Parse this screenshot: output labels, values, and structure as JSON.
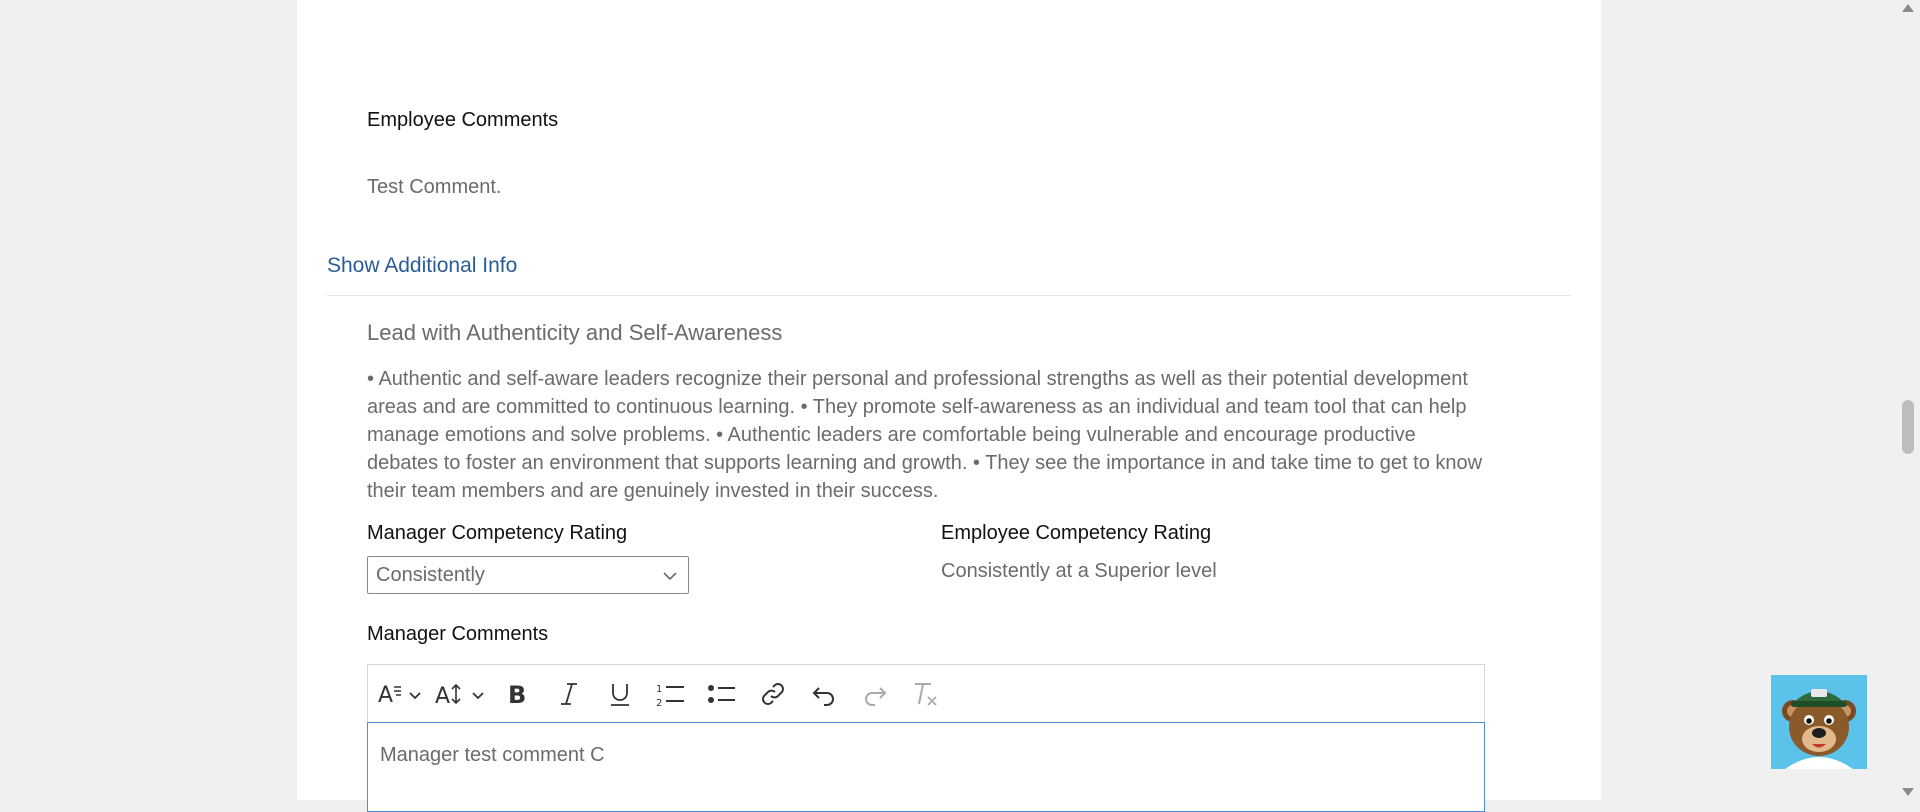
{
  "employee_comments": {
    "label": "Employee Comments",
    "text": "Test Comment."
  },
  "show_additional_info": "Show Additional Info",
  "competency": {
    "title": "Lead with Authenticity and Self-Awareness",
    "description": "• Authentic and self-aware leaders recognize their personal and professional strengths as well as their potential development areas and are committed to continuous learning. • They promote self-awareness as an individual and team tool that can help manage emotions and solve problems. • Authentic leaders are comfortable being vulnerable and encourage productive debates to foster an environment that supports learning and growth. • They see the importance in and take time to get to know their team members and are genuinely invested in their success.",
    "manager_rating_label": "Manager Competency Rating",
    "manager_rating_value": "Consistently",
    "employee_rating_label": "Employee Competency Rating",
    "employee_rating_value": "Consistently at a Superior level"
  },
  "manager_comments": {
    "label": "Manager Comments",
    "text": "Manager test comment C"
  },
  "toolbar": {
    "items": [
      "font-style-icon",
      "font-size-icon",
      "bold-icon",
      "italic-icon",
      "underline-icon",
      "numbered-list-icon",
      "bulleted-list-icon",
      "link-icon",
      "undo-icon",
      "redo-icon",
      "clear-formatting-icon"
    ]
  },
  "colors": {
    "link": "#2a5c98",
    "muted_text": "#6b6b6b",
    "editor_focus": "#4f8edc",
    "mascot_bg": "#5bc2ea"
  }
}
